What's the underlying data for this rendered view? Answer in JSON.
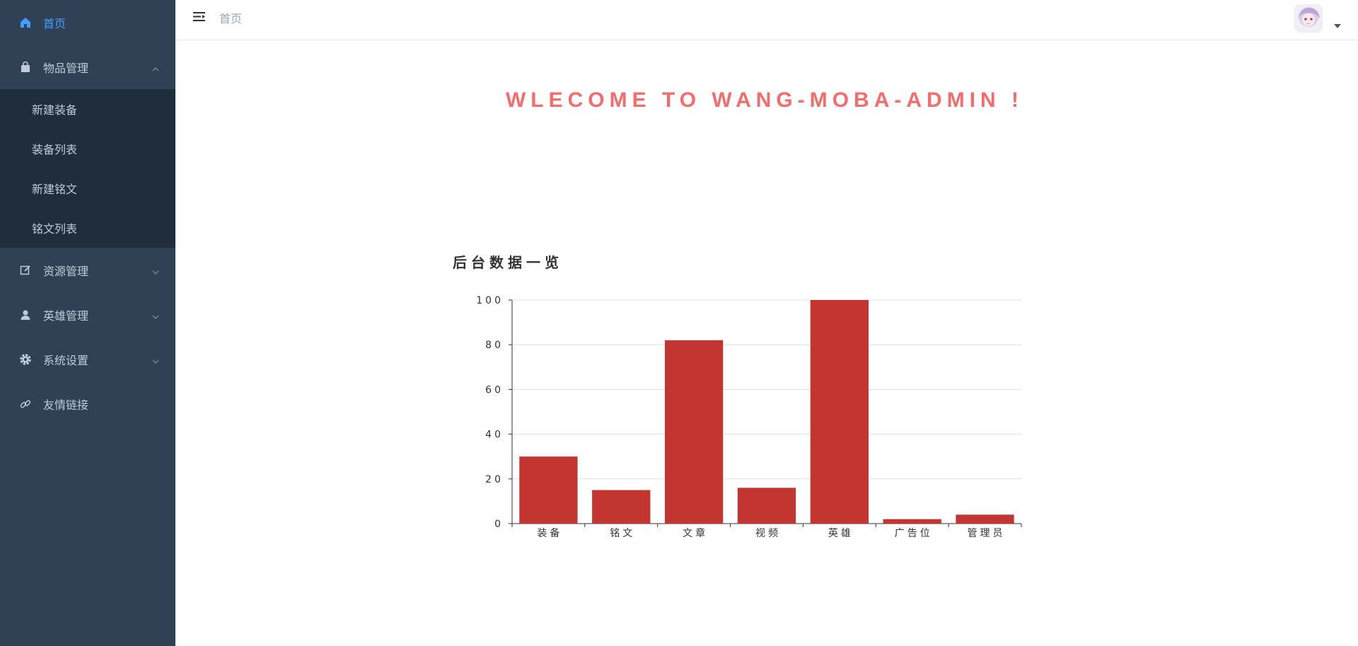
{
  "sidebar": {
    "home": "首页",
    "goods": {
      "label": "物品管理",
      "items": [
        "新建装备",
        "装备列表",
        "新建铭文",
        "铭文列表"
      ]
    },
    "resources": "资源管理",
    "heroes": "英雄管理",
    "settings": "系统设置",
    "links": "友情链接"
  },
  "header": {
    "breadcrumb": "首页"
  },
  "welcome": "WLECOME TO WANG-MOBA-ADMIN !",
  "chart_data": {
    "type": "bar",
    "title": "后台数据一览",
    "categories": [
      "装备",
      "铭文",
      "文章",
      "视频",
      "英雄",
      "广告位",
      "管理员"
    ],
    "values": [
      30,
      15,
      82,
      16,
      100,
      2,
      4
    ],
    "ylim": [
      0,
      100
    ],
    "yticks": [
      0,
      20,
      40,
      60,
      80,
      100
    ],
    "grid": true,
    "bar_color": "#c23531"
  },
  "colors": {
    "sidebar_bg": "#304156",
    "submenu_bg": "#1f2d3d",
    "active": "#409eff",
    "welcome": "#f56c6c"
  }
}
